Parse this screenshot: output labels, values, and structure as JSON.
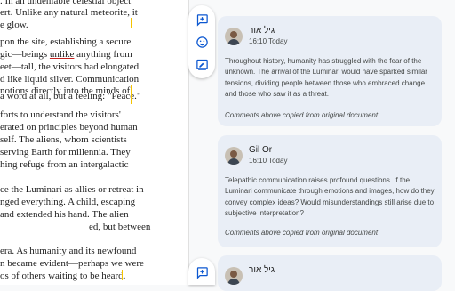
{
  "document": {
    "lines": [
      ". In an undeniable celestial object",
      "ert. Unlike any natural meteorite, it",
      "e glow.",
      "",
      "pon the site, establishing a secure",
      "gic—beings unlike anything from",
      "eet—tall, the visitors had elongated",
      "d like liquid silver. Communication",
      "notions directly into the minds of",
      "a word at all, but a feeling: \"Peace.\"",
      "",
      "forts to understand the visitors'",
      "erated on principles beyond human",
      "self. The aliens, whom scientists",
      "serving Earth for millennia. They",
      "hing refuge from an intergalactic",
      "",
      "ce the Luminari as allies or retreat in",
      "nged everything. A child, escaping",
      "and extended his hand. The alien",
      "ed, but between",
      "",
      "era. As humanity and its newfound",
      "n became evident—perhaps we were",
      "os of others waiting to be heard."
    ],
    "line6_pre": "gic—beings ",
    "line6_underlined": "unlike",
    "line6_post": " anything from"
  },
  "toolbar": {
    "add_comment_icon": "add-comment-icon",
    "emoji_icon": "emoji-reaction-icon",
    "suggest_edit_icon": "suggest-edit-icon"
  },
  "comments": [
    {
      "author": "גיל אור",
      "time": "16:10 Today",
      "text": "Throughout history, humanity has struggled with the fear of the unknown. The arrival of the Luminari would have sparked similar tensions, dividing people between those who embraced change and those who saw it as a threat.",
      "note": "Comments above copied from original document"
    },
    {
      "author": "Gil Or",
      "time": "16:10 Today",
      "text": "Telepathic communication raises profound questions. If the Luminari communicate through emotions and images, how do they convey complex ideas? Would misunderstandings still arise due to subjective interpretation?",
      "note": "Comments above copied from original document"
    },
    {
      "author": "גיל אור"
    }
  ],
  "colors": {
    "card_bg": "#e9eef6",
    "accent": "#0b57d0",
    "highlight": "#f5c400"
  }
}
